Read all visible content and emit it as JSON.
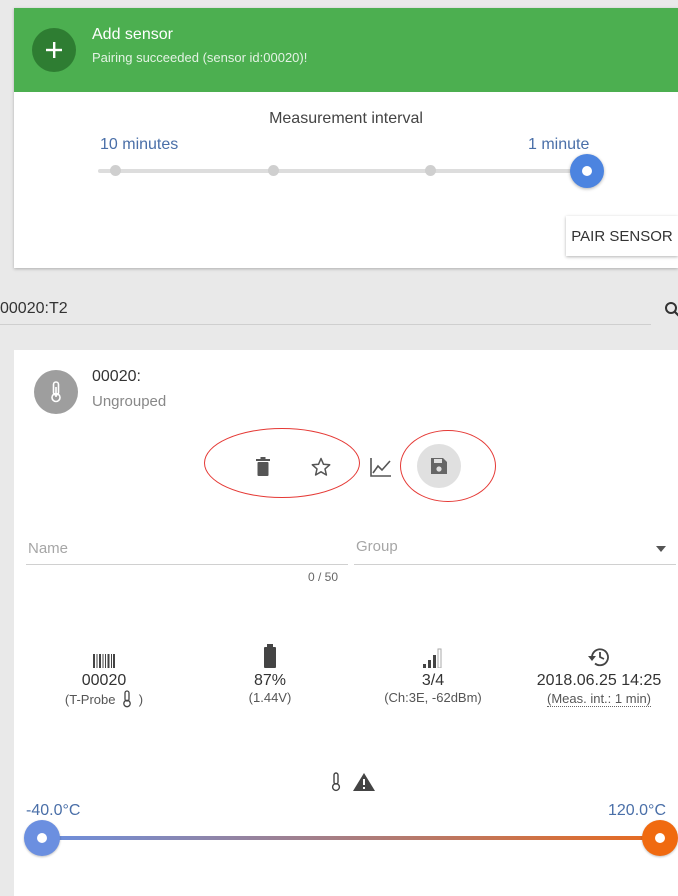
{
  "banner": {
    "title": "Add sensor",
    "subtitle": "Pairing succeeded (sensor id:00020)!",
    "color": "#4caf50",
    "icon": "plus-icon"
  },
  "interval": {
    "title": "Measurement interval",
    "left_label": "10 minutes",
    "right_label": "1 minute",
    "steps": 4,
    "selected_step": 4
  },
  "pair_button": {
    "label": "PAIR SENSOR"
  },
  "search": {
    "value": "00020:T2",
    "icon": "search-icon"
  },
  "sensor": {
    "id": "00020:",
    "group": "Ungrouped",
    "avatar_icon": "thermometer-icon"
  },
  "actions": {
    "delete_icon": "trash-icon",
    "favorite_icon": "star-outline-icon",
    "chart_icon": "line-chart-icon",
    "save_icon": "floppy-disk-icon"
  },
  "form": {
    "name_placeholder": "Name",
    "name_counter": "0 / 50",
    "group_placeholder": "Group"
  },
  "info": {
    "serial": {
      "value": "00020",
      "sub": "(T-Probe",
      "sub_end": ")",
      "icon": "barcode-icon"
    },
    "battery": {
      "value": "87%",
      "sub": "(1.44V)",
      "icon": "battery-icon"
    },
    "signal": {
      "value": "3/4",
      "sub": "(Ch:3E, -62dBm)",
      "icon": "signal-icon"
    },
    "last_seen": {
      "value": "2018.06.25 14:25",
      "sub": "(Meas. int.: 1 min)",
      "icon": "history-icon"
    }
  },
  "alarm": {
    "icons": [
      "thermometer-icon",
      "warning-icon"
    ],
    "min_label": "-40.0°C",
    "max_label": "120.0°C",
    "min_color": "#6b8fe0",
    "max_color": "#f06a10"
  }
}
